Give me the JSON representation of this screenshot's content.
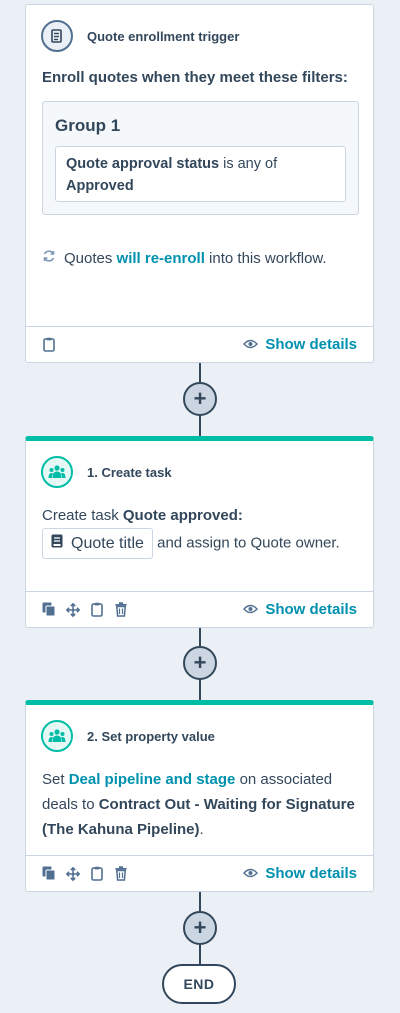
{
  "trigger": {
    "title": "Quote enrollment trigger",
    "filter_heading": "Enroll quotes when they meet these filters:",
    "group_title": "Group 1",
    "filter_property": "Quote approval status",
    "filter_operator": " is any of",
    "filter_value": "Approved",
    "reenroll_prefix": "Quotes ",
    "reenroll_link": "will re-enroll",
    "reenroll_suffix": " into this workflow.",
    "show_details": "Show details"
  },
  "actions": [
    {
      "title": "1. Create task",
      "text_prefix": "Create task ",
      "task_name": "Quote approved:",
      "token_label": "Quote title",
      "text_suffix": " and assign to Quote owner.",
      "show_details": "Show details"
    },
    {
      "title": "2. Set property value",
      "text_set": "Set ",
      "property_link": "Deal pipeline and stage",
      "text_mid": " on associated deals to ",
      "value": "Contract Out - Waiting for Signature (The Kahuna Pipeline)",
      "text_end": ".",
      "show_details": "Show details"
    }
  ],
  "end_label": "END",
  "colors": {
    "accent": "#00bda5",
    "link": "#0091ae",
    "text": "#33475b",
    "border": "#cbd6e2",
    "background": "#eaf0f6"
  }
}
